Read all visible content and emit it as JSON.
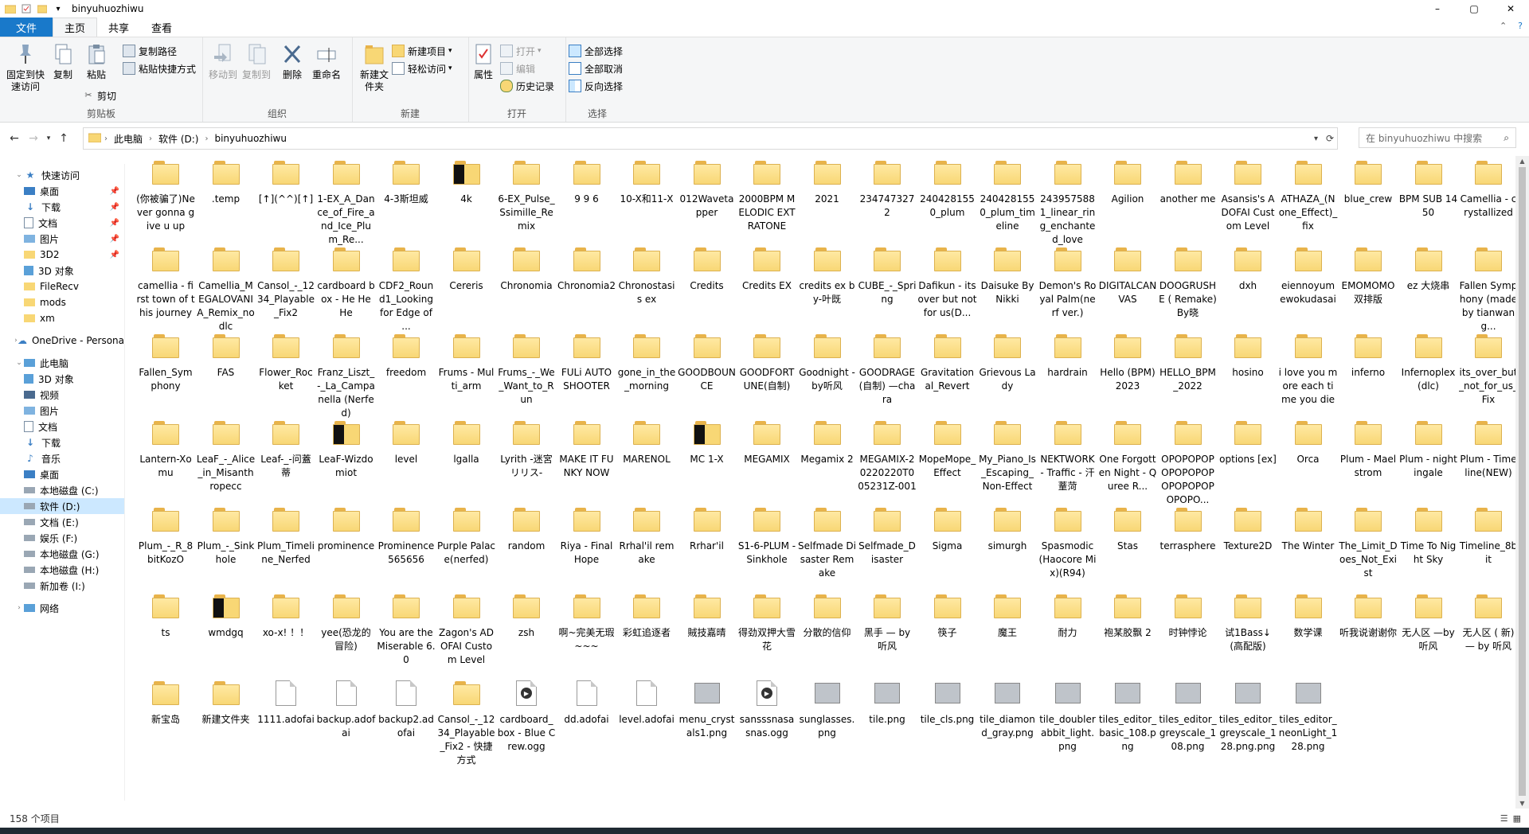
{
  "window": {
    "title": "binyuhuozhiwu",
    "controls": [
      "–",
      "▢",
      "✕"
    ]
  },
  "menu": {
    "tabs": [
      {
        "label": "文件"
      },
      {
        "label": "主页"
      },
      {
        "label": "共享"
      },
      {
        "label": "查看"
      }
    ]
  },
  "ribbon": {
    "clipboard": {
      "group_label": "剪贴板",
      "pin_label": "固定到快速访问",
      "copy_label": "复制",
      "paste_label": "粘贴",
      "copy_path_label": "复制路径",
      "paste_shortcut_label": "粘贴快捷方式",
      "cut_label": "剪切"
    },
    "organize": {
      "group_label": "组织",
      "move_to_label": "移动到",
      "copy_to_label": "复制到",
      "delete_label": "删除",
      "rename_label": "重命名"
    },
    "new": {
      "group_label": "新建",
      "new_folder_label": "新建文件夹",
      "new_item_label": "新建项目",
      "easy_access_label": "轻松访问"
    },
    "open": {
      "group_label": "打开",
      "properties_label": "属性",
      "open_label": "打开",
      "edit_label": "编辑",
      "history_label": "历史记录"
    },
    "select": {
      "group_label": "选择",
      "select_all_label": "全部选择",
      "select_none_label": "全部取消",
      "invert_label": "反向选择"
    }
  },
  "address": {
    "crumbs": [
      "此电脑",
      "软件 (D:)",
      "binyuhuozhiwu"
    ],
    "search_placeholder": "在 binyuhuozhiwu 中搜索"
  },
  "nav": {
    "items": [
      {
        "label": "快速访问"
      },
      {
        "label": "桌面"
      },
      {
        "label": "下载"
      },
      {
        "label": "文档"
      },
      {
        "label": "图片"
      },
      {
        "label": "3D2"
      },
      {
        "label": "3D 对象"
      },
      {
        "label": "FileRecv"
      },
      {
        "label": "mods"
      },
      {
        "label": "xm"
      },
      {
        "label": "OneDrive - Persona"
      },
      {
        "label": "此电脑"
      },
      {
        "label": "3D 对象"
      },
      {
        "label": "视频"
      },
      {
        "label": "图片"
      },
      {
        "label": "文档"
      },
      {
        "label": "下载"
      },
      {
        "label": "音乐"
      },
      {
        "label": "桌面"
      },
      {
        "label": "本地磁盘 (C:)"
      },
      {
        "label": "软件 (D:)"
      },
      {
        "label": "文档 (E:)"
      },
      {
        "label": "娱乐 (F:)"
      },
      {
        "label": "本地磁盘 (G:)"
      },
      {
        "label": "本地磁盘 (H:)"
      },
      {
        "label": "新加卷 (I:)"
      },
      {
        "label": "网络"
      }
    ]
  },
  "files": [
    {
      "name": "(你被骗了)Never gonna give u up",
      "kind": "folder"
    },
    {
      "name": ".temp",
      "kind": "folder"
    },
    {
      "name": "[↑](^^)[↑]",
      "kind": "folder"
    },
    {
      "name": "1-EX_A_Dance_of_Fire_and_Ice_Plum_Re...",
      "kind": "folder"
    },
    {
      "name": "4-3斯坦威",
      "kind": "folder"
    },
    {
      "name": "4k",
      "kind": "folder-dark"
    },
    {
      "name": "6-EX_Pulse_Ssimille_Remix",
      "kind": "folder"
    },
    {
      "name": "9 9 6",
      "kind": "folder"
    },
    {
      "name": "10-X和11-X",
      "kind": "folder"
    },
    {
      "name": "012Wavetapper",
      "kind": "folder"
    },
    {
      "name": "2000BPM MELODIC EXTRATONE",
      "kind": "folder"
    },
    {
      "name": "2021",
      "kind": "folder"
    },
    {
      "name": "2347473272",
      "kind": "folder"
    },
    {
      "name": "2404281550_plum",
      "kind": "folder"
    },
    {
      "name": "2404281550_plum_timeline",
      "kind": "folder"
    },
    {
      "name": "2439575881_linear_ring_enchanted_love",
      "kind": "folder"
    },
    {
      "name": "Agilion",
      "kind": "folder"
    },
    {
      "name": "another me",
      "kind": "folder"
    },
    {
      "name": "Asansis's ADOFAI Custom Level",
      "kind": "folder"
    },
    {
      "name": "ATHAZA_(None_Effect)_fix",
      "kind": "folder"
    },
    {
      "name": "blue_crew",
      "kind": "folder"
    },
    {
      "name": "BPM SUB 1450",
      "kind": "folder"
    },
    {
      "name": "Camellia - crystallized",
      "kind": "folder"
    },
    {
      "name": "camellia - first town of this journey",
      "kind": "folder"
    },
    {
      "name": "Camellia_MEGALOVANIA_Remix_nodlc",
      "kind": "folder"
    },
    {
      "name": "Cansol_-_1234_Playable_Fix2",
      "kind": "folder"
    },
    {
      "name": "cardboard box - He He He",
      "kind": "folder"
    },
    {
      "name": "CDF2_Round1_Looking for Edge of ...",
      "kind": "folder"
    },
    {
      "name": "Cereris",
      "kind": "folder"
    },
    {
      "name": "Chronomia",
      "kind": "folder"
    },
    {
      "name": "Chronomia2",
      "kind": "folder"
    },
    {
      "name": "Chronostasis ex",
      "kind": "folder"
    },
    {
      "name": "Credits",
      "kind": "folder"
    },
    {
      "name": "Credits EX",
      "kind": "folder"
    },
    {
      "name": "credits ex by-叶既",
      "kind": "folder"
    },
    {
      "name": "CUBE_-_Spring",
      "kind": "folder"
    },
    {
      "name": "Dafikun - its over but not for us(D...",
      "kind": "folder"
    },
    {
      "name": "Daisuke By Nikki",
      "kind": "folder"
    },
    {
      "name": "Demon's Royal Palm(nerf ver.)",
      "kind": "folder"
    },
    {
      "name": "DIGITALCANVAS",
      "kind": "folder"
    },
    {
      "name": "DOOGRUSH E ( Remake) By晓",
      "kind": "folder"
    },
    {
      "name": "dxh",
      "kind": "folder"
    },
    {
      "name": "eiennoyumewokudasai",
      "kind": "folder"
    },
    {
      "name": "EMOMOMO双排版",
      "kind": "folder"
    },
    {
      "name": "ez 大烧串",
      "kind": "folder"
    },
    {
      "name": "Fallen Symphony (made by tianwang...",
      "kind": "folder"
    },
    {
      "name": "Fallen_Symphony",
      "kind": "folder"
    },
    {
      "name": "FAS",
      "kind": "folder"
    },
    {
      "name": "Flower_Rocket",
      "kind": "folder"
    },
    {
      "name": "Franz_Liszt_-_La_Campanella (Nerfed)",
      "kind": "folder"
    },
    {
      "name": "freedom",
      "kind": "folder"
    },
    {
      "name": "Frums - Multi_arm",
      "kind": "folder"
    },
    {
      "name": "Frums_-_We_Want_to_Run",
      "kind": "folder"
    },
    {
      "name": "FULi AUTO SHOOTER",
      "kind": "folder"
    },
    {
      "name": "gone_in_the_morning",
      "kind": "folder"
    },
    {
      "name": "GOODBOUNCE",
      "kind": "folder"
    },
    {
      "name": "GOODFORTUNE(自制)",
      "kind": "folder"
    },
    {
      "name": "Goodnight - by听风",
      "kind": "folder"
    },
    {
      "name": "GOODRAGE (自制) —chara",
      "kind": "folder"
    },
    {
      "name": "Gravitational_Revert",
      "kind": "folder"
    },
    {
      "name": "Grievous Lady",
      "kind": "folder"
    },
    {
      "name": "hardrain",
      "kind": "folder"
    },
    {
      "name": "Hello (BPM) 2023",
      "kind": "folder"
    },
    {
      "name": "HELLO_BPM_2022",
      "kind": "folder"
    },
    {
      "name": "hosino",
      "kind": "folder"
    },
    {
      "name": "i love you more each time you die",
      "kind": "folder"
    },
    {
      "name": "inferno",
      "kind": "folder"
    },
    {
      "name": "Infernoplex (dlc)",
      "kind": "folder"
    },
    {
      "name": "its_over_but_not_for_us_Fix",
      "kind": "folder"
    },
    {
      "name": "Lantern-Xomu",
      "kind": "folder"
    },
    {
      "name": "LeaF_-_Alice_in_Misanthropecc",
      "kind": "folder"
    },
    {
      "name": "Leaf-_-问蓋蒂",
      "kind": "folder"
    },
    {
      "name": "LeaF-Wizdomiot",
      "kind": "folder-dark"
    },
    {
      "name": "level",
      "kind": "folder"
    },
    {
      "name": "lgalla",
      "kind": "folder"
    },
    {
      "name": "Lyrith -迷宮リリス-",
      "kind": "folder"
    },
    {
      "name": "MAKE IT FUNKY NOW",
      "kind": "folder"
    },
    {
      "name": "MARENOL",
      "kind": "folder"
    },
    {
      "name": "MC 1-X",
      "kind": "folder-dark"
    },
    {
      "name": "MEGAMIX",
      "kind": "folder"
    },
    {
      "name": "Megamix 2",
      "kind": "folder"
    },
    {
      "name": "MEGAMIX-20220220T005231Z-001",
      "kind": "folder"
    },
    {
      "name": "MopeMope_Effect",
      "kind": "folder"
    },
    {
      "name": "My_Piano_Is_Escaping_Non-Effect",
      "kind": "folder"
    },
    {
      "name": "NEKTWORK - Traffic - 汗蕫菏",
      "kind": "folder"
    },
    {
      "name": "One Forgotten Night - Quree R...",
      "kind": "folder"
    },
    {
      "name": "OPOPOPOPOPOPOPOPOPOPOPOPOPOPO...",
      "kind": "folder"
    },
    {
      "name": "options [ex]",
      "kind": "folder"
    },
    {
      "name": "Orca",
      "kind": "folder"
    },
    {
      "name": "Plum - Maelstrom",
      "kind": "folder"
    },
    {
      "name": "Plum - nightingale",
      "kind": "folder"
    },
    {
      "name": "Plum - Timeline(NEW)",
      "kind": "folder"
    },
    {
      "name": "Plum_-_R_8bitKozO",
      "kind": "folder"
    },
    {
      "name": "Plum_-_Sinkhole",
      "kind": "folder"
    },
    {
      "name": "Plum_Timeline_Nerfed",
      "kind": "folder"
    },
    {
      "name": "prominence",
      "kind": "folder"
    },
    {
      "name": "Prominence565656",
      "kind": "folder"
    },
    {
      "name": "Purple Palace(nerfed)",
      "kind": "folder"
    },
    {
      "name": "random",
      "kind": "folder"
    },
    {
      "name": "Riya - Final Hope",
      "kind": "folder"
    },
    {
      "name": "Rrhal'il remake",
      "kind": "folder"
    },
    {
      "name": "Rrhar'il",
      "kind": "folder"
    },
    {
      "name": "S1-6-PLUM - Sinkhole",
      "kind": "folder"
    },
    {
      "name": "Selfmade Disaster Remake",
      "kind": "folder"
    },
    {
      "name": "Selfmade_Disaster",
      "kind": "folder"
    },
    {
      "name": "Sigma",
      "kind": "folder"
    },
    {
      "name": "simurgh",
      "kind": "folder"
    },
    {
      "name": "Spasmodic (Haocore Mix)(R94)",
      "kind": "folder"
    },
    {
      "name": "Stas",
      "kind": "folder"
    },
    {
      "name": "terrasphere",
      "kind": "folder"
    },
    {
      "name": "Texture2D",
      "kind": "folder"
    },
    {
      "name": "The Winter",
      "kind": "folder"
    },
    {
      "name": "The_Limit_Does_Not_Exist",
      "kind": "folder"
    },
    {
      "name": "Time To Night Sky",
      "kind": "folder"
    },
    {
      "name": "Timeline_8bit",
      "kind": "folder"
    },
    {
      "name": "ts",
      "kind": "folder"
    },
    {
      "name": "wmdgq",
      "kind": "folder-dark"
    },
    {
      "name": "xo-x! ！！",
      "kind": "folder"
    },
    {
      "name": "yee(恐龙的冒险)",
      "kind": "folder"
    },
    {
      "name": "You are the Miserable 6.0",
      "kind": "folder"
    },
    {
      "name": "Zagon's ADOFAI Custom Level",
      "kind": "folder"
    },
    {
      "name": "zsh",
      "kind": "folder"
    },
    {
      "name": "啊~完美无瑕~~~",
      "kind": "folder"
    },
    {
      "name": "彩虹追逐者",
      "kind": "folder"
    },
    {
      "name": "賊技嘉晴",
      "kind": "folder"
    },
    {
      "name": "得劲双押大雪花",
      "kind": "folder"
    },
    {
      "name": "分散的信仰",
      "kind": "folder"
    },
    {
      "name": "黑手 — by 听风",
      "kind": "folder"
    },
    {
      "name": "筷子",
      "kind": "folder"
    },
    {
      "name": "魔王",
      "kind": "folder"
    },
    {
      "name": "耐力",
      "kind": "folder"
    },
    {
      "name": "袍某胶飘 2",
      "kind": "folder"
    },
    {
      "name": "时钟悖论",
      "kind": "folder"
    },
    {
      "name": "试1Bass↓(高配版)",
      "kind": "folder"
    },
    {
      "name": "数学课",
      "kind": "folder"
    },
    {
      "name": "听我说谢谢你",
      "kind": "folder"
    },
    {
      "name": "无人区 —by听风",
      "kind": "folder"
    },
    {
      "name": "无人区 ( 新) — by 听风",
      "kind": "folder"
    },
    {
      "name": "新宝岛",
      "kind": "folder"
    },
    {
      "name": "新建文件夹",
      "kind": "folder"
    },
    {
      "name": "1111.adofai",
      "kind": "file"
    },
    {
      "name": "backup.adofai",
      "kind": "file"
    },
    {
      "name": "backup2.adofai",
      "kind": "file"
    },
    {
      "name": "Cansol_-_1234_Playable_Fix2 - 快捷方式",
      "kind": "folder"
    },
    {
      "name": "cardboard_box - Blue Crew.ogg",
      "kind": "media"
    },
    {
      "name": "dd.adofai",
      "kind": "file"
    },
    {
      "name": "level.adofai",
      "kind": "file"
    },
    {
      "name": "menu_crystals1.png",
      "kind": "image"
    },
    {
      "name": "sansssnasasnas.ogg",
      "kind": "media"
    },
    {
      "name": "sunglasses.png",
      "kind": "image"
    },
    {
      "name": "tile.png",
      "kind": "image"
    },
    {
      "name": "tile_cls.png",
      "kind": "image"
    },
    {
      "name": "tile_diamond_gray.png",
      "kind": "image"
    },
    {
      "name": "tile_doublerabbit_light.png",
      "kind": "image"
    },
    {
      "name": "tiles_editor_basic_108.png",
      "kind": "image"
    },
    {
      "name": "tiles_editor_greyscale_108.png",
      "kind": "image"
    },
    {
      "name": "tiles_editor_greyscale_128.png.png",
      "kind": "image"
    },
    {
      "name": "tiles_editor_neonLight_128.png",
      "kind": "image"
    }
  ],
  "status": {
    "count": "158 个项目"
  },
  "colors": {
    "accent": "#1979ca",
    "folder": "#f8d775",
    "selection": "#cce8ff"
  }
}
